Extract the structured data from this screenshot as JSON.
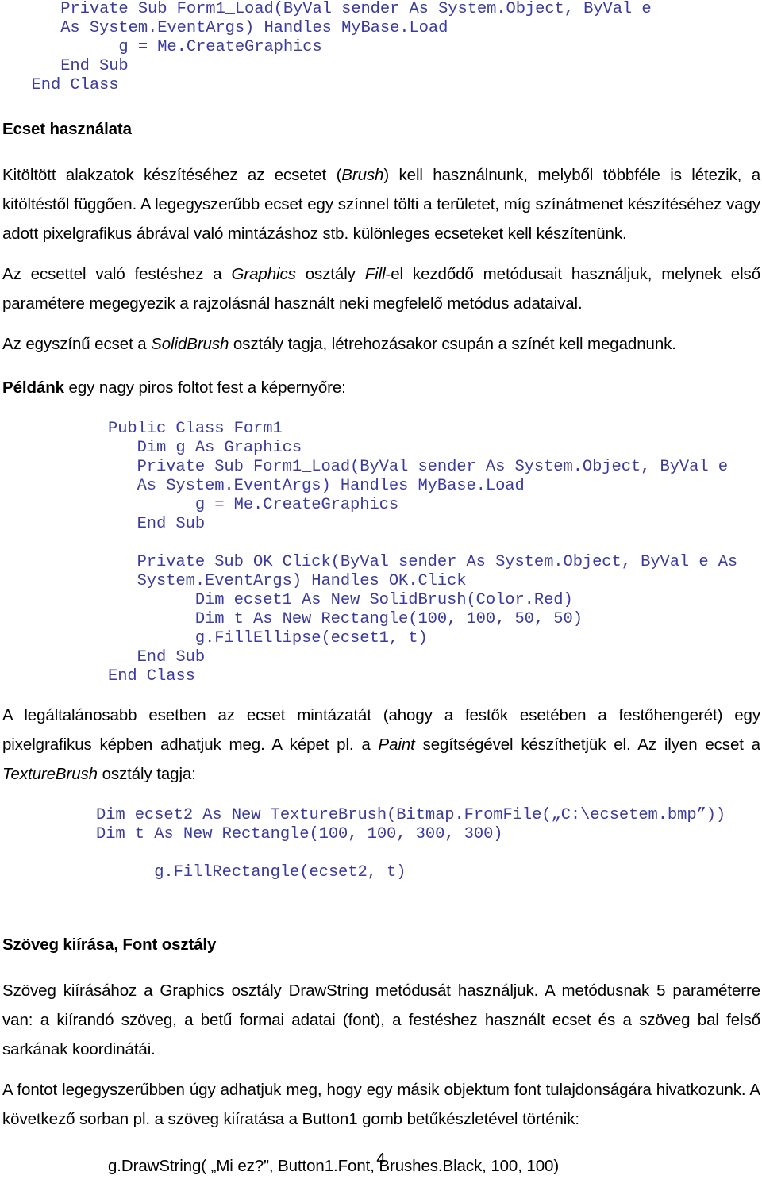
{
  "document": {
    "page_number": "4",
    "code_color": "#3b3b9e",
    "text_color": "#000000",
    "background": "#ffffff"
  },
  "code_top": {
    "lines": [
      "      Private Sub Form1_Load(ByVal sender As System.Object, ByVal e",
      "      As System.EventArgs) Handles MyBase.Load",
      "            g = Me.CreateGraphics",
      "      End Sub",
      "   End Class"
    ],
    "raw": "      Private Sub Form1_Load(ByVal sender As System.Object, ByVal e\n      As System.EventArgs) Handles MyBase.Load\n            g = Me.CreateGraphics\n      End Sub\n   End Class"
  },
  "section_brush": {
    "heading": "Ecset használata",
    "paragraph1_part1": "Kitöltött alakzatok készítéséhez az ecsetet (",
    "paragraph1_italic1": "Brush",
    "paragraph1_part2": ") kell használnunk, melyből többféle is létezik, a kitöltéstől függően. A legegyszerűbb ecset egy színnel tölti a területet, míg színátmenet készítéséhez vagy adott pixelgrafikus ábrával való mintázáshoz stb. különleges ecseteket kell készítenünk.",
    "paragraph2_part1": "Az ecsettel való festéshez a ",
    "paragraph2_italic1": "Graphics",
    "paragraph2_part2": " osztály ",
    "paragraph2_italic2": "Fill",
    "paragraph2_part3": "-el kezdődő metódusait használjuk, melynek első paramétere megegyezik a rajzolásnál használt neki megfelelő metódus adataival.",
    "paragraph3_part1": "Az egyszínű ecset a ",
    "paragraph3_italic1": "SolidBrush",
    "paragraph3_part2": " osztály tagja, létrehozásakor csupán a színét kell megadnunk.",
    "paragraph4_bold": "Példánk",
    "paragraph4_rest": " egy nagy piros foltot fest a képernyőre:"
  },
  "code_example_solidbrush": {
    "raw": "Public Class Form1\n   Dim g As Graphics\n   Private Sub Form1_Load(ByVal sender As System.Object, ByVal e\n   As System.EventArgs) Handles MyBase.Load\n         g = Me.CreateGraphics\n   End Sub\n\n   Private Sub OK_Click(ByVal sender As System.Object, ByVal e As\n   System.EventArgs) Handles OK.Click\n         Dim ecset1 As New SolidBrush(Color.Red)\n         Dim t As New Rectangle(100, 100, 50, 50)\n         g.FillEllipse(ecset1, t)\n   End Sub\nEnd Class",
    "lines": [
      "Public Class Form1",
      "   Dim g As Graphics",
      "   Private Sub Form1_Load(ByVal sender As System.Object, ByVal e",
      "   As System.EventArgs) Handles MyBase.Load",
      "         g = Me.CreateGraphics",
      "   End Sub",
      "",
      "   Private Sub OK_Click(ByVal sender As System.Object, ByVal e As",
      "   System.EventArgs) Handles OK.Click",
      "         Dim ecset1 As New SolidBrush(Color.Red)",
      "         Dim t As New Rectangle(100, 100, 50, 50)",
      "         g.FillEllipse(ecset1, t)",
      "   End Sub",
      "End Class"
    ]
  },
  "section_texture": {
    "paragraph1_part1": "A legáltalánosabb esetben az ecset mintázatát (ahogy a festők esetében a festőhengerét) egy pixelgrafikus képben adhatjuk meg. A képet pl. a ",
    "paragraph1_italic1": "Paint",
    "paragraph1_part2": " segítségével készíthetjük el. Az ilyen ecset a ",
    "paragraph1_italic2": "TextureBrush",
    "paragraph1_part3": " osztály tagja:"
  },
  "code_example_texturebrush": {
    "raw": "Dim ecset2 As New TextureBrush(Bitmap.FromFile(„C:\\ecsetem.bmp”))\nDim t As New Rectangle(100, 100, 300, 300)\n\n      g.FillRectangle(ecset2, t)",
    "lines": [
      "Dim ecset2 As New TextureBrush(Bitmap.FromFile(„C:\\ecsetem.bmp”))",
      "Dim t As New Rectangle(100, 100, 300, 300)",
      "",
      "      g.FillRectangle(ecset2, t)"
    ]
  },
  "section_font": {
    "heading": "Szöveg kiírása, Font osztály",
    "paragraph1": "Szöveg kiírásához a Graphics osztály DrawString metódusát használjuk. A metódusnak 5 paraméterre van: a kiírandó szöveg, a betű formai adatai (font), a festéshez használt ecset és a szöveg bal felső sarkának koordinátái.",
    "paragraph2": "A fontot legegyszerűbben úgy adhatjuk meg, hogy egy másik objektum font tulajdonságára hivatkozunk. A következő sorban pl. a szöveg kiíratása a Button1 gomb betűkészletével történik:",
    "example_line": "g.DrawString( „Mi ez?”, Button1.Font, Brushes.Black, 100, 100)"
  }
}
